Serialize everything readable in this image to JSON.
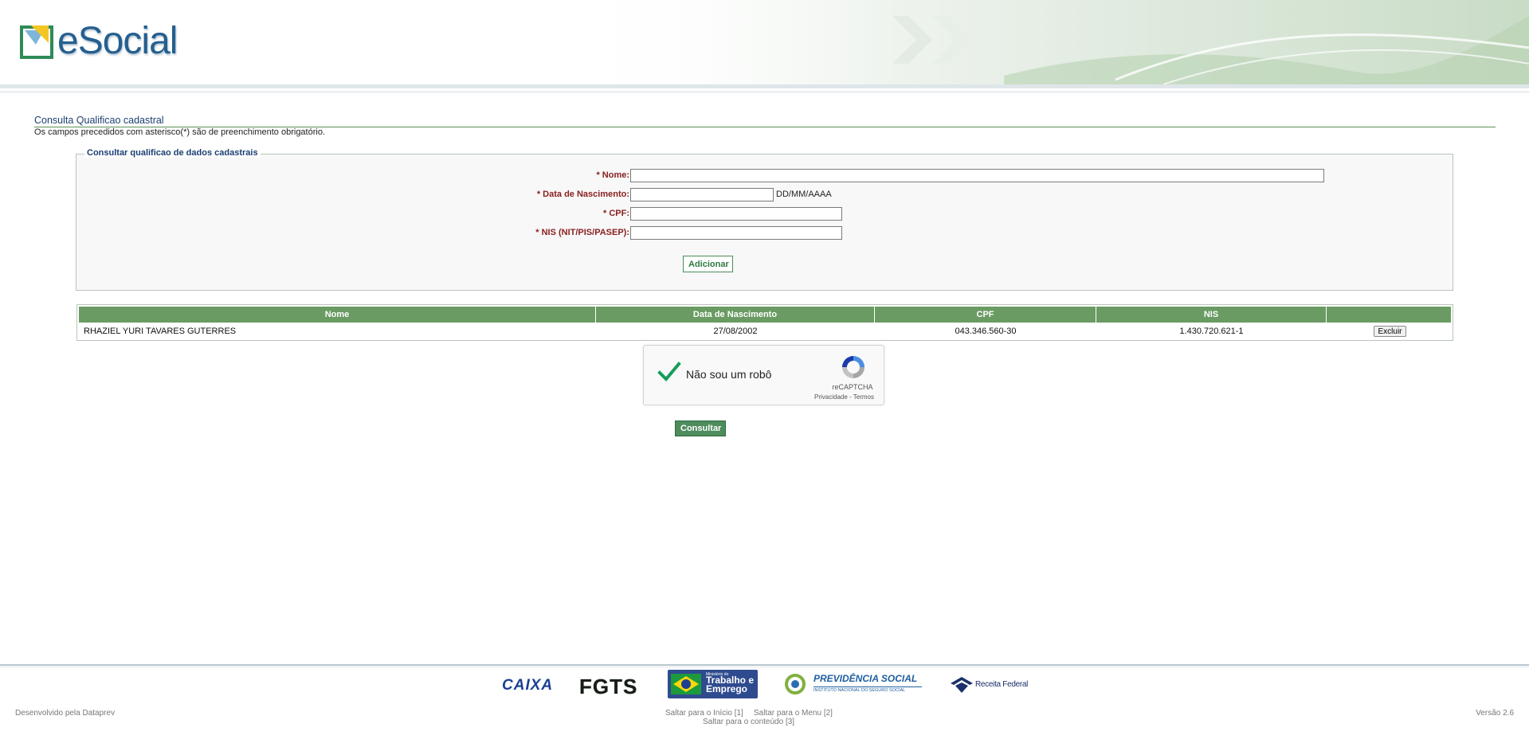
{
  "header": {
    "logo_text": "eSocial"
  },
  "page": {
    "title": "Consulta Qualificao cadastral",
    "subtitle": "Os campos precedidos com asterisco(*) são de preenchimento obrigatório."
  },
  "form": {
    "legend": "Consultar qualificao de dados cadastrais",
    "nome_label": "* Nome:",
    "nome_value": "",
    "data_label": "* Data de Nascimento:",
    "data_value": "",
    "data_hint": "DD/MM/AAAA",
    "cpf_label": "* CPF:",
    "cpf_value": "",
    "nis_label": "* NIS (NIT/PIS/PASEP):",
    "nis_value": "",
    "add_button": "Adicionar"
  },
  "table": {
    "headers": [
      "Nome",
      "Data de Nascimento",
      "CPF",
      "NIS",
      ""
    ],
    "rows": [
      {
        "nome": "RHAZIEL YURI TAVARES GUTERRES",
        "data": "27/08/2002",
        "cpf": "043.346.560-30",
        "nis": "1.430.720.621-1",
        "action": "Excluir"
      }
    ]
  },
  "captcha": {
    "label": "Não sou um robô",
    "brand": "reCAPTCHA",
    "privacy": "Privacidade",
    "separator": " - ",
    "terms": "Termos",
    "checked": true
  },
  "consultar_button": "Consultar",
  "footer": {
    "logos": [
      "CAIXA",
      "FGTS",
      "Trabalho e Emprego",
      "PREVIDÊNCIA SOCIAL",
      "Receita Federal"
    ],
    "ministry_small": "Ministério do",
    "previdencia_sub": "INSTITUTO NACIONAL DO SEGURO SOCIAL",
    "developed_by": "Desenvolvido pela Dataprev",
    "skip_inicio": "Saltar para o Início [1]",
    "skip_menu": "Saltar para o Menu [2]",
    "skip_conteudo": "Saltar para o conteúdo [3]",
    "version": "Versão 2.6"
  },
  "colors": {
    "accent_green": "#6a9b63",
    "title_blue": "#1b3f73",
    "label_red": "#8a2020"
  }
}
